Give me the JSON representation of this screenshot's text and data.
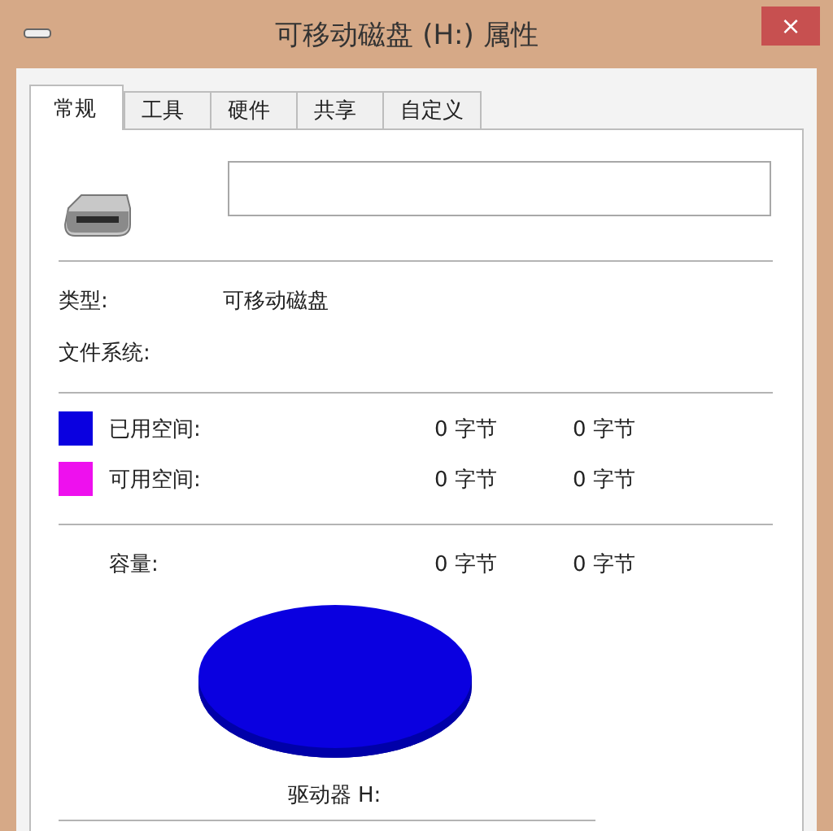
{
  "window": {
    "title": "可移动磁盘 (H:) 属性",
    "close": "×"
  },
  "tabs": [
    {
      "label": "常规",
      "selected": true
    },
    {
      "label": "工具",
      "selected": false
    },
    {
      "label": "硬件",
      "selected": false
    },
    {
      "label": "共享",
      "selected": false
    },
    {
      "label": "自定义",
      "selected": false
    }
  ],
  "info": [
    {
      "label": "类型:",
      "value": "可移动磁盘"
    },
    {
      "label": "文件系统:"
    }
  ],
  "space": [
    {
      "label": "已用空间:",
      "color": "#0a00e0",
      "bytes": "0 字节",
      "size": "0 字节"
    },
    {
      "label": "可用空间:",
      "color": "#ee10ee",
      "bytes": "0 字节",
      "size": "0 字节"
    }
  ],
  "capacity": {
    "label": "容量:",
    "bytes": "0 字节",
    "size": "0 字节"
  },
  "drive_label": "驱动器 H:"
}
